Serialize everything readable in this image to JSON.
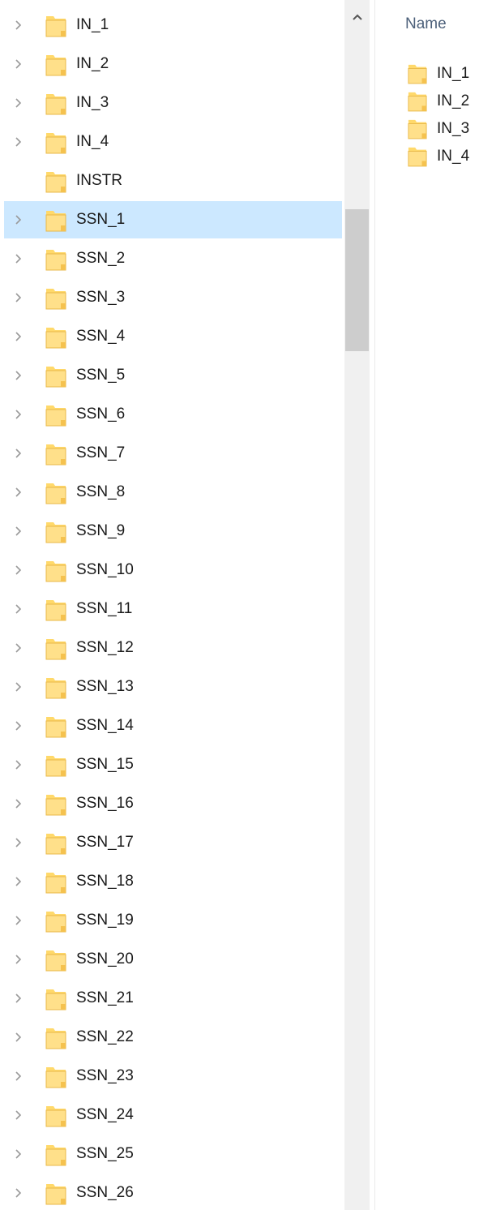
{
  "navigation": {
    "items": [
      {
        "label": "IN_1",
        "has_children": true,
        "selected": false
      },
      {
        "label": "IN_2",
        "has_children": true,
        "selected": false
      },
      {
        "label": "IN_3",
        "has_children": true,
        "selected": false
      },
      {
        "label": "IN_4",
        "has_children": true,
        "selected": false
      },
      {
        "label": "INSTR",
        "has_children": false,
        "selected": false
      },
      {
        "label": "SSN_1",
        "has_children": true,
        "selected": true
      },
      {
        "label": "SSN_2",
        "has_children": true,
        "selected": false
      },
      {
        "label": "SSN_3",
        "has_children": true,
        "selected": false
      },
      {
        "label": "SSN_4",
        "has_children": true,
        "selected": false
      },
      {
        "label": "SSN_5",
        "has_children": true,
        "selected": false
      },
      {
        "label": "SSN_6",
        "has_children": true,
        "selected": false
      },
      {
        "label": "SSN_7",
        "has_children": true,
        "selected": false
      },
      {
        "label": "SSN_8",
        "has_children": true,
        "selected": false
      },
      {
        "label": "SSN_9",
        "has_children": true,
        "selected": false
      },
      {
        "label": "SSN_10",
        "has_children": true,
        "selected": false
      },
      {
        "label": "SSN_11",
        "has_children": true,
        "selected": false
      },
      {
        "label": "SSN_12",
        "has_children": true,
        "selected": false
      },
      {
        "label": "SSN_13",
        "has_children": true,
        "selected": false
      },
      {
        "label": "SSN_14",
        "has_children": true,
        "selected": false
      },
      {
        "label": "SSN_15",
        "has_children": true,
        "selected": false
      },
      {
        "label": "SSN_16",
        "has_children": true,
        "selected": false
      },
      {
        "label": "SSN_17",
        "has_children": true,
        "selected": false
      },
      {
        "label": "SSN_18",
        "has_children": true,
        "selected": false
      },
      {
        "label": "SSN_19",
        "has_children": true,
        "selected": false
      },
      {
        "label": "SSN_20",
        "has_children": true,
        "selected": false
      },
      {
        "label": "SSN_21",
        "has_children": true,
        "selected": false
      },
      {
        "label": "SSN_22",
        "has_children": true,
        "selected": false
      },
      {
        "label": "SSN_23",
        "has_children": true,
        "selected": false
      },
      {
        "label": "SSN_24",
        "has_children": true,
        "selected": false
      },
      {
        "label": "SSN_25",
        "has_children": true,
        "selected": false
      },
      {
        "label": "SSN_26",
        "has_children": true,
        "selected": false
      }
    ],
    "expand_icon": "chevron-right-icon",
    "item_icon": "folder-icon",
    "selected_color": "#cce8ff"
  },
  "scrollbar": {
    "up_icon": "chevron-up-icon",
    "position": 0.18
  },
  "content": {
    "column_header": "Name",
    "items": [
      {
        "label": "IN_1"
      },
      {
        "label": "IN_2"
      },
      {
        "label": "IN_3"
      },
      {
        "label": "IN_4"
      }
    ]
  },
  "colors": {
    "folder_fill": "#ffd96b",
    "folder_light": "#ffe9a3",
    "header_text": "#4c607a"
  }
}
